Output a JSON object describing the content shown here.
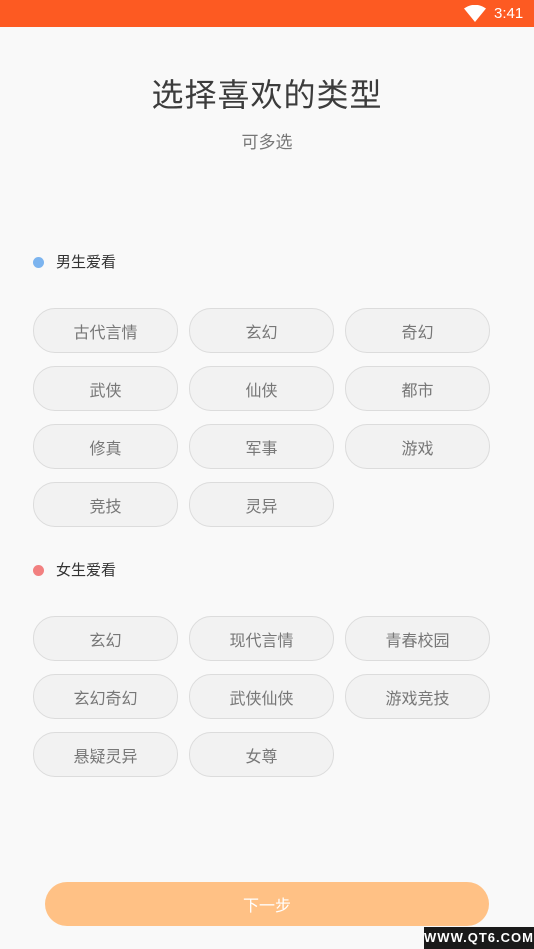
{
  "status_bar": {
    "time": "3:41",
    "wifi_icon": "wifi-icon",
    "bg_color": "#fd5a22"
  },
  "header": {
    "title": "选择喜欢的类型",
    "subtitle": "可多选"
  },
  "sections": [
    {
      "label": "男生爱看",
      "dot_color": "#7cb4ef",
      "tags": [
        "古代言情",
        "玄幻",
        "奇幻",
        "武侠",
        "仙侠",
        "都市",
        "修真",
        "军事",
        "游戏",
        "竞技",
        "灵异"
      ]
    },
    {
      "label": "女生爱看",
      "dot_color": "#f28080",
      "tags": [
        "玄幻",
        "现代言情",
        "青春校园",
        "玄幻奇幻",
        "武侠仙侠",
        "游戏竞技",
        "悬疑灵异",
        "女尊"
      ]
    }
  ],
  "footer": {
    "next_label": "下一步",
    "button_color": "#ffc185"
  },
  "watermark": "WWW.QT6.COM"
}
